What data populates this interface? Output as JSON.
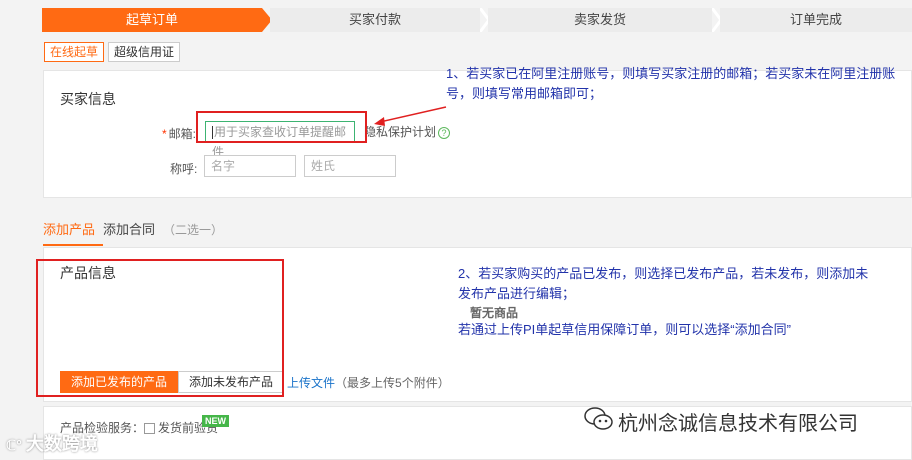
{
  "steps": [
    "起草订单",
    "买家付款",
    "卖家发货",
    "订单完成"
  ],
  "mode_tabs": [
    "在线起草",
    "超级信用证"
  ],
  "buyer": {
    "title": "买家信息",
    "email_label": "邮箱:",
    "email_placeholder": "用于买家查收订单提醒邮件",
    "privacy_label": "隐私保护计划",
    "salutation_label": "称呼:",
    "first_name_placeholder": "名字",
    "last_name_placeholder": "姓氏"
  },
  "product_tabs": {
    "add_product": "添加产品",
    "add_contract": "添加合同",
    "note": "（二选一）"
  },
  "product": {
    "title": "产品信息",
    "empty_text": "暂无商品",
    "add_published_button": "添加已发布的产品",
    "add_unpublished_button": "添加未发布产品",
    "upload_link": "上传文件",
    "upload_note": "（最多上传5个附件）"
  },
  "inspection": {
    "label": "产品检验服务：",
    "checkbox_label": "发货前验货",
    "badge": "NEW"
  },
  "annotations": {
    "note1": "1、若买家已在阿里注册账号，则填写买家注册的邮箱；若买家未在阿里注册账号，则填写常用邮箱即可；",
    "note2_line1": "2、若买家购买的产品已发布，则选择已发布产品，若未发布，则添加未发布产品进行编辑；",
    "note2_line2": "若通过上传PI单起草信用保障订单，则可以选择“添加合同”"
  },
  "watermarks": {
    "right": "杭州念诚信息技术有限公司",
    "left": "大数跨境"
  },
  "colors": {
    "accent": "#ff6a13",
    "annotation": "#2233aa",
    "highlight_box": "#e02020"
  }
}
